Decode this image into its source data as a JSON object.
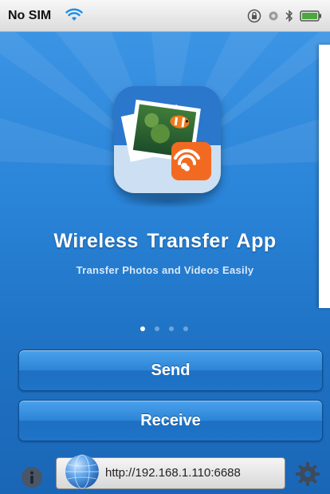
{
  "status_bar": {
    "carrier": "No SIM",
    "icons": [
      "wifi-icon",
      "rotation-lock-icon",
      "location-icon",
      "bluetooth-icon",
      "battery-icon"
    ]
  },
  "app_icon": {
    "name": "wireless-transfer-app-icon"
  },
  "hero": {
    "title": "Wireless Transfer App",
    "subtitle": "Transfer Photos and Videos Easily"
  },
  "pager": {
    "total": 4,
    "active": 0
  },
  "buttons": {
    "send": "Send",
    "receive": "Receive"
  },
  "bottom_bar": {
    "url": "http://192.168.1.110:6688",
    "icons": [
      "info-icon",
      "globe-icon",
      "gear-icon"
    ]
  },
  "colors": {
    "background": "#2a84d8",
    "button": "#2c84d6",
    "text": "#ffffff"
  }
}
